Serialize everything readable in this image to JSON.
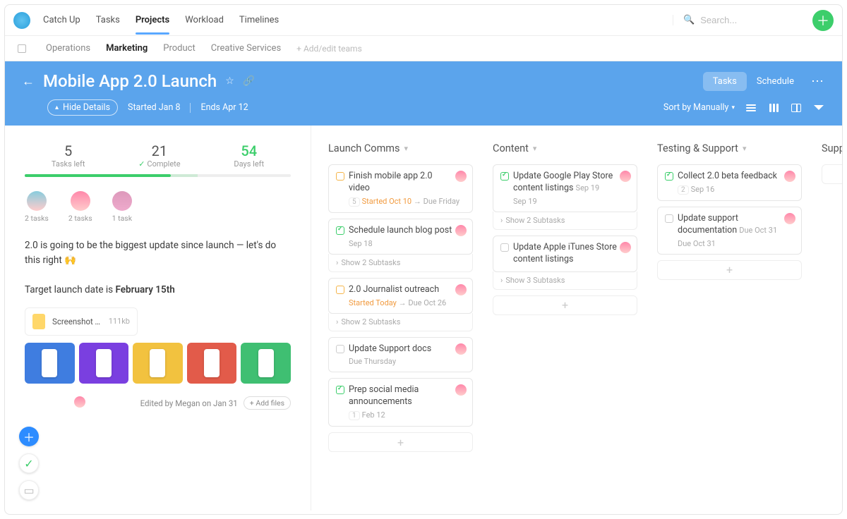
{
  "nav": {
    "items": [
      "Catch Up",
      "Tasks",
      "Projects",
      "Workload",
      "Timelines"
    ],
    "active_index": 2,
    "search_placeholder": "Search..."
  },
  "teams": {
    "items": [
      "Operations",
      "Marketing",
      "Product",
      "Creative Services"
    ],
    "active_index": 1,
    "add_edit_label": "+ Add/edit teams"
  },
  "project": {
    "title": "Mobile App 2.0 Launch",
    "views": {
      "tasks": "Tasks",
      "schedule": "Schedule"
    },
    "hide_details": "Hide Details",
    "started": "Started Jan 8",
    "ends": "Ends Apr 12",
    "sort_label": "Sort by Manually"
  },
  "details": {
    "tasks_left": "5",
    "tasks_left_label": "Tasks left",
    "complete": "21",
    "complete_label": "Complete",
    "days_left": "54",
    "days_left_label": "Days left",
    "members": [
      {
        "tasks": "2 tasks"
      },
      {
        "tasks": "2 tasks"
      },
      {
        "tasks": "1 task"
      }
    ],
    "desc_line1_a": "2.0 is going to be the biggest update since launch — let's do this right 🙌",
    "desc_line2_a": "Target launch date is ",
    "desc_line2_b": "February 15th",
    "attachment": {
      "name": "Screenshot Temp…",
      "size": "111kb"
    },
    "thumbs": [
      "#3f7de0",
      "#7a3fe0",
      "#f2c23f",
      "#e25b4a",
      "#3fbf72"
    ],
    "edited_by": "Edited by Megan on Jan 31",
    "add_files": "+ Add files"
  },
  "columns": [
    {
      "name": "Launch Comms",
      "cards": [
        {
          "status": "pending",
          "title": "Finish mobile app 2.0 video",
          "meta_badge": "5",
          "meta_started": "Started Oct 10",
          "meta_arrow": "→",
          "meta_due": "Due Friday",
          "assignee": true
        },
        {
          "status": "done",
          "title": "Schedule launch blog post",
          "meta_plain": "Sep 18",
          "assignee": true,
          "subtasks": "Show 2 Subtasks"
        },
        {
          "status": "pending",
          "title": "2.0 Journalist outreach",
          "meta_started": "Started Today",
          "meta_arrow": "→",
          "meta_due_inline": "Due Oct 26",
          "assignee": true,
          "subtasks": "Show 2 Subtasks"
        },
        {
          "status": "open",
          "title": "Update Support docs",
          "meta_plain": "Due Thursday",
          "assignee": true
        },
        {
          "status": "done",
          "title": "Prep social media announcements",
          "meta_badge": "1",
          "meta_plain": "Feb 12",
          "assignee": true
        }
      ]
    },
    {
      "name": "Content",
      "cards": [
        {
          "status": "done",
          "title": "Update Google Play Store content listings",
          "meta_inline": "Sep 19",
          "assignee": true,
          "subtasks": "Show 2 Subtasks"
        },
        {
          "status": "open",
          "title": "Update Apple iTunes Store content listings",
          "assignee": true,
          "subtasks": "Show 3 Subtasks"
        }
      ]
    },
    {
      "name": "Testing & Support",
      "cards": [
        {
          "status": "done",
          "title": "Collect 2.0 beta feedback",
          "meta_badge": "2",
          "meta_inline": "Sep 16",
          "assignee": true
        },
        {
          "status": "open",
          "title": "Update support documentation",
          "meta_inline": "Due Oct 31",
          "assignee": true
        }
      ]
    },
    {
      "name": "Support",
      "cards": []
    }
  ]
}
